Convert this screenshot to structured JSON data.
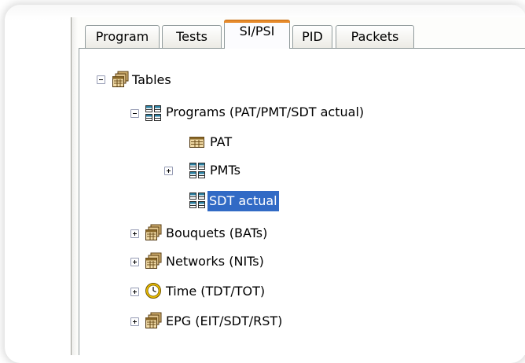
{
  "tabs": [
    {
      "label": "Program",
      "active": false
    },
    {
      "label": "Tests",
      "active": false
    },
    {
      "label": "SI/PSI",
      "active": true
    },
    {
      "label": "PID",
      "active": false
    },
    {
      "label": "Packets",
      "active": false
    }
  ],
  "tree": {
    "root": {
      "label": "Tables",
      "icon": "table-stack-icon",
      "expanded": true
    },
    "programs": {
      "label": "Programs (PAT/PMT/SDT actual)",
      "icon": "grid-table-icon",
      "expanded": true
    },
    "pat": {
      "label": "PAT",
      "icon": "single-table-icon"
    },
    "pmts": {
      "label": "PMTs",
      "icon": "grid-table-icon",
      "expanded": false
    },
    "sdt_actual": {
      "label": "SDT actual",
      "icon": "grid-table-icon",
      "selected": true
    },
    "bouquets": {
      "label": "Bouquets (BATs)",
      "icon": "table-stack-icon",
      "expanded": false
    },
    "networks": {
      "label": "Networks (NITs)",
      "icon": "table-stack-icon",
      "expanded": false
    },
    "time": {
      "label": "Time (TDT/TOT)",
      "icon": "clock-icon",
      "expanded": false
    },
    "epg": {
      "label": "EPG (EIT/SDT/RST)",
      "icon": "table-stack-icon",
      "expanded": false
    }
  },
  "colors": {
    "active_tab_accent": "#e68b2c",
    "selection": "#316ac5"
  }
}
